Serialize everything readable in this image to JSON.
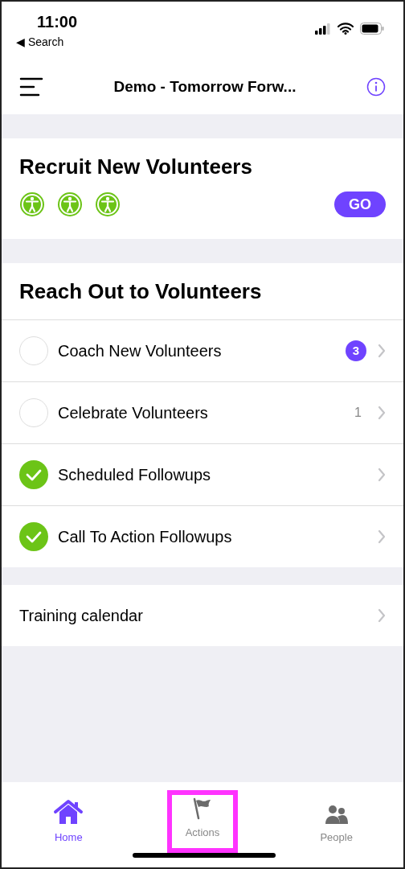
{
  "status_bar": {
    "time": "11:00",
    "back_label": "◀ Search"
  },
  "nav": {
    "title": "Demo - Tomorrow Forw..."
  },
  "recruit": {
    "title": "Recruit New Volunteers",
    "icons": [
      {
        "kind": "accessibility"
      },
      {
        "kind": "accessibility"
      },
      {
        "kind": "accessibility"
      }
    ],
    "button": "GO"
  },
  "reach_out": {
    "title": "Reach Out to Volunteers",
    "items": [
      {
        "label": "Coach New Volunteers",
        "checked": false,
        "count": "3",
        "kind": "badge"
      },
      {
        "label": "Celebrate Volunteers",
        "checked": false,
        "count": "1",
        "kind": "plain"
      },
      {
        "label": "Scheduled Followups",
        "checked": true
      },
      {
        "label": "Call To Action Followups",
        "checked": true
      }
    ]
  },
  "links": [
    {
      "label": "Training calendar"
    }
  ],
  "tab_bar": [
    {
      "label": "Home",
      "kind": "home",
      "selected": true,
      "highlighted": false
    },
    {
      "label": "Actions",
      "kind": "flag",
      "selected": false,
      "highlighted": true
    },
    {
      "label": "People",
      "kind": "people",
      "selected": false,
      "highlighted": false
    }
  ]
}
